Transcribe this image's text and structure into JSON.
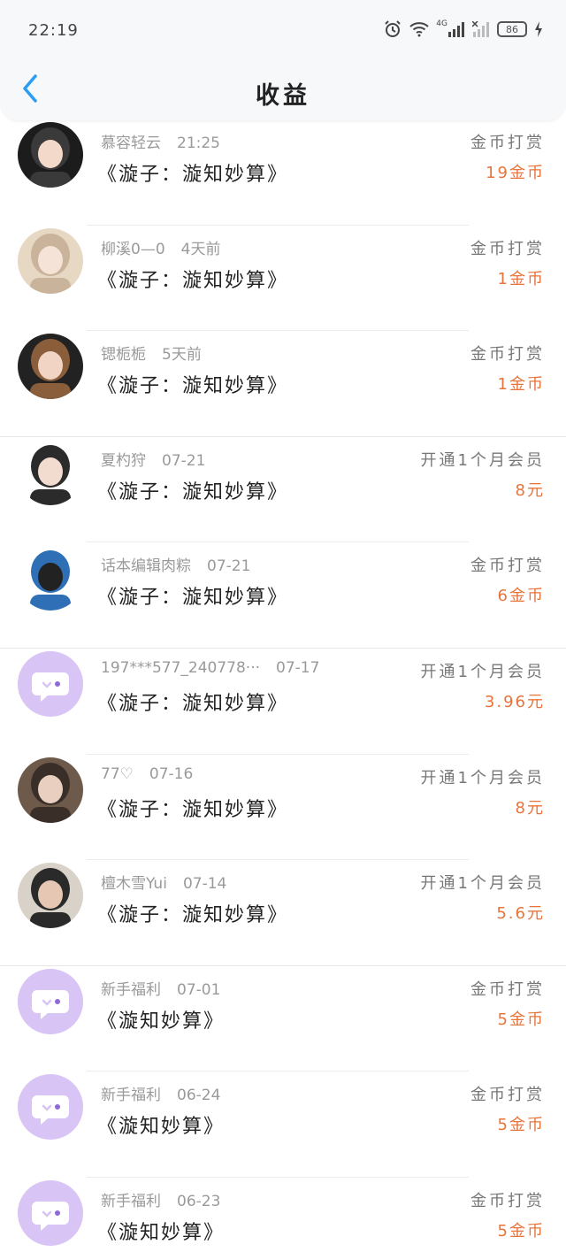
{
  "status_bar": {
    "time": "22:19",
    "network": "4G",
    "battery": "86"
  },
  "header": {
    "title": "收益"
  },
  "colors": {
    "amount": "#e8743a",
    "back_arrow": "#2a9df4",
    "placeholder_avatar": "#d8c4f5"
  },
  "items": [
    {
      "name": "慕容轻云",
      "time": "21:25",
      "book": "《漩子：漩知妙算》",
      "type": "金币打赏",
      "amount": "19金币",
      "avatar": "photo"
    },
    {
      "name": "柳溪0—0",
      "time": "4天前",
      "book": "《漩子：漩知妙算》",
      "type": "金币打赏",
      "amount": "1金币",
      "avatar": "photo"
    },
    {
      "name": "锶栀栀",
      "time": "5天前",
      "book": "《漩子：漩知妙算》",
      "type": "金币打赏",
      "amount": "1金币",
      "avatar": "photo"
    },
    {
      "name": "夏杓狩",
      "time": "07-21",
      "book": "《漩子：漩知妙算》",
      "type": "开通1个月会员",
      "amount": "8元",
      "avatar": "photo"
    },
    {
      "name": "话本编辑肉粽",
      "time": "07-21",
      "book": "《漩子：漩知妙算》",
      "type": "金币打赏",
      "amount": "6金币",
      "avatar": "photo"
    },
    {
      "name": "197***577_240778···",
      "time": "07-17",
      "book": "《漩子：漩知妙算》",
      "type": "开通1个月会员",
      "amount": "3.96元",
      "avatar": "default"
    },
    {
      "name": "77♡",
      "time": "07-16",
      "book": "《漩子：漩知妙算》",
      "type": "开通1个月会员",
      "amount": "8元",
      "avatar": "photo"
    },
    {
      "name": "檀木雪Yui",
      "time": "07-14",
      "book": "《漩子：漩知妙算》",
      "type": "开通1个月会员",
      "amount": "5.6元",
      "avatar": "photo"
    },
    {
      "name": "新手福利",
      "time": "07-01",
      "book": "《漩知妙算》",
      "type": "金币打赏",
      "amount": "5金币",
      "avatar": "default"
    },
    {
      "name": "新手福利",
      "time": "06-24",
      "book": "《漩知妙算》",
      "type": "金币打赏",
      "amount": "5金币",
      "avatar": "default"
    },
    {
      "name": "新手福利",
      "time": "06-23",
      "book": "《漩知妙算》",
      "type": "金币打赏",
      "amount": "5金币",
      "avatar": "default"
    }
  ]
}
